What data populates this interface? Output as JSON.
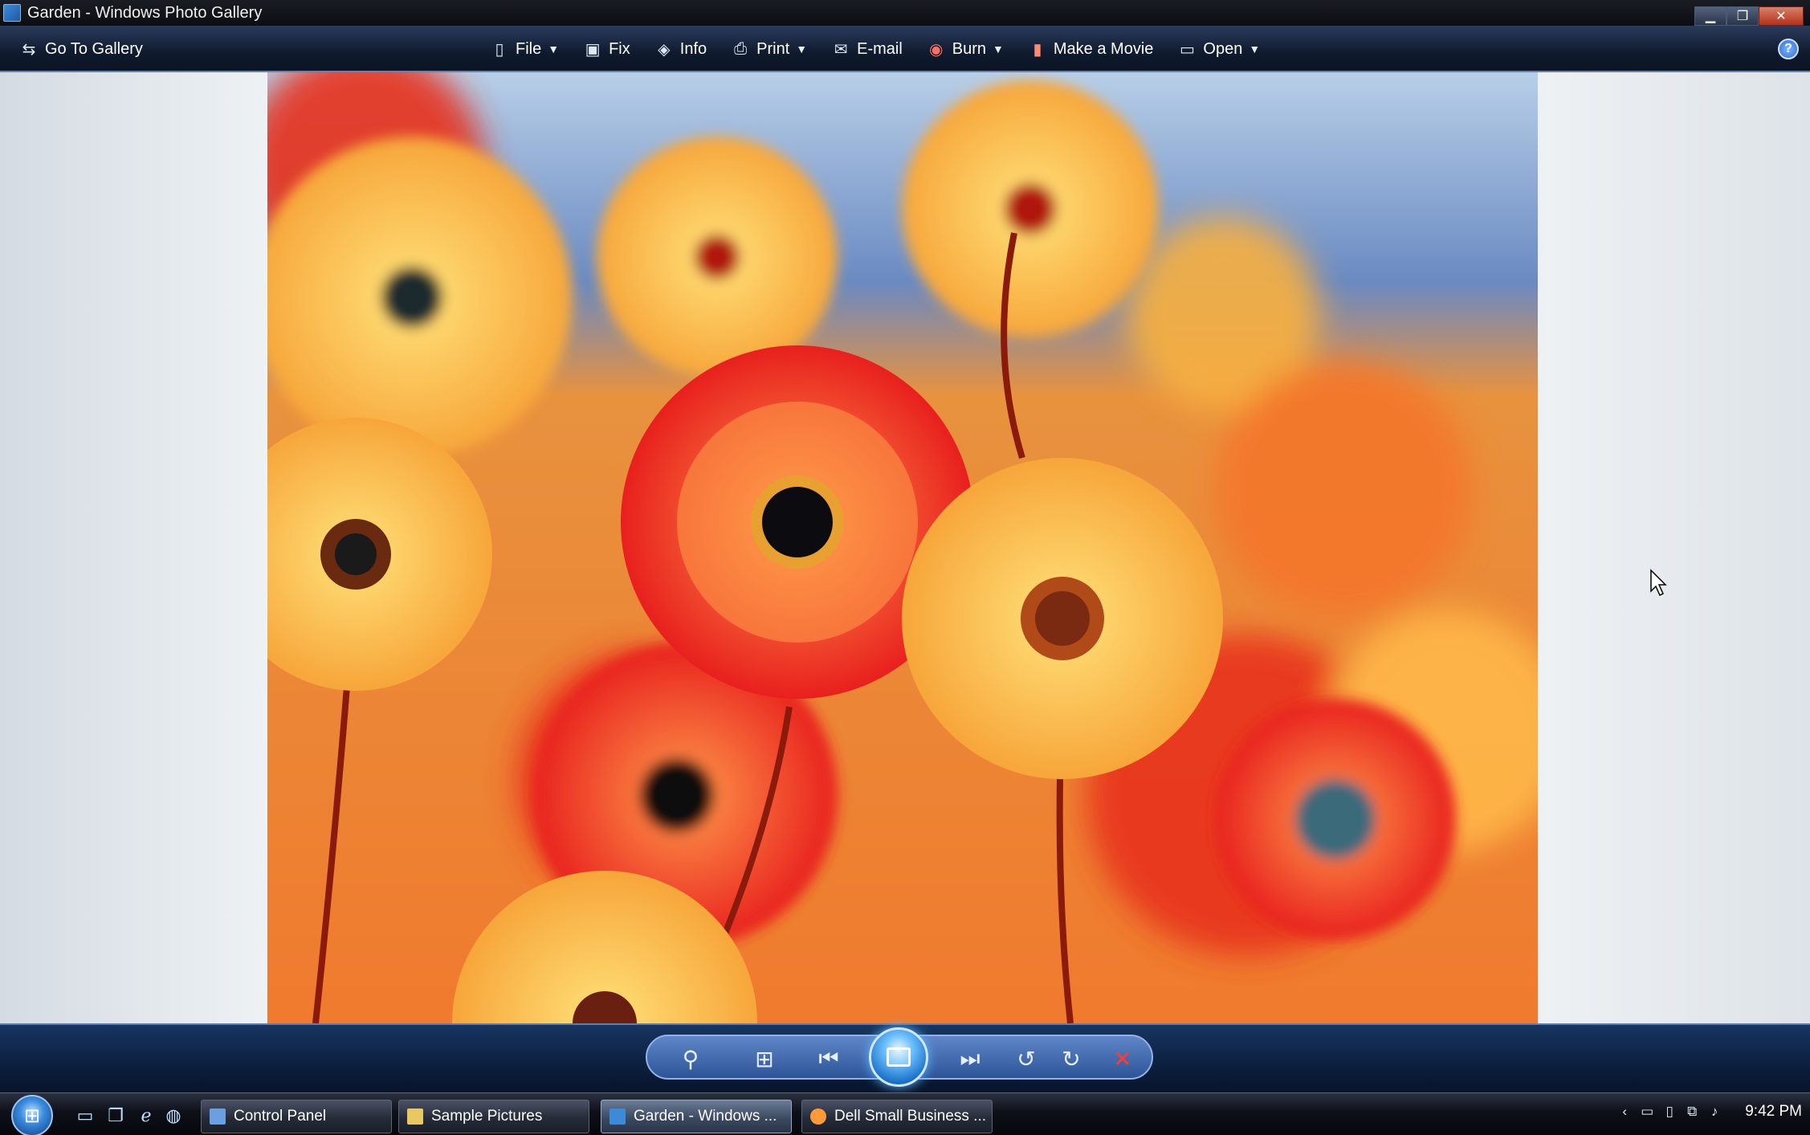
{
  "window": {
    "title": "Garden - Windows Photo Gallery"
  },
  "toolbar": {
    "go_to_gallery": "Go To Gallery",
    "file": "File",
    "fix": "Fix",
    "info": "Info",
    "print": "Print",
    "email": "E-mail",
    "burn": "Burn",
    "make_movie": "Make a Movie",
    "open": "Open",
    "help": "?"
  },
  "taskbar": {
    "buttons": [
      {
        "label": "Control Panel"
      },
      {
        "label": "Sample Pictures"
      },
      {
        "label": "Garden - Windows ..."
      },
      {
        "label": "Dell Small Business ..."
      }
    ],
    "clock": "9:42 PM"
  },
  "colors": {
    "accent": "#2d5496",
    "close_red": "#ff3b30",
    "photo_orange": "#f2823a"
  },
  "icons": {
    "toolbar": [
      "go-to-gallery-icon",
      "file-icon",
      "fix-icon",
      "info-icon",
      "print-icon",
      "email-icon",
      "burn-icon",
      "movie-icon",
      "open-icon",
      "help-icon"
    ],
    "controls": [
      "zoom-icon",
      "actual-size-icon",
      "previous-icon",
      "slideshow-icon",
      "next-icon",
      "rotate-ccw-icon",
      "rotate-cw-icon",
      "delete-icon"
    ]
  }
}
